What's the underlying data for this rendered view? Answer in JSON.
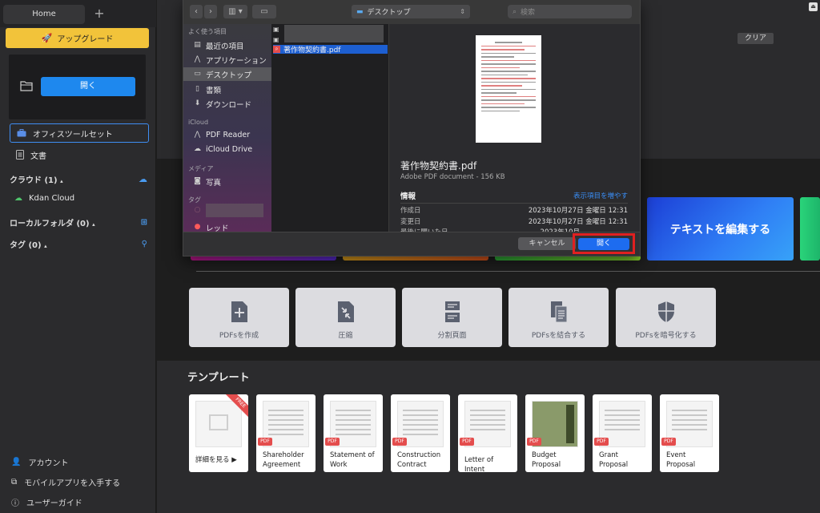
{
  "tabs": {
    "home": "Home",
    "add": "+"
  },
  "sidebar": {
    "upgrade": "アップグレード",
    "open_button": "開く",
    "office_toolset": "オフィスツールセット",
    "documents": "文書",
    "cloud": "クラウド (1)",
    "kdan_cloud": "Kdan Cloud",
    "local_folder": "ローカルフォルダ (0)",
    "tags": "タグ (0)",
    "account": "アカウント",
    "mobile_app": "モバイルアプリを入手する",
    "user_guide": "ユーザーガイド"
  },
  "main": {
    "clear": "クリア",
    "banner_edit_text": "テキストを編集する",
    "tools": [
      {
        "label": "PDFsを作成"
      },
      {
        "label": "圧縮"
      },
      {
        "label": "分割頁面"
      },
      {
        "label": "PDFsを結合する"
      },
      {
        "label": "PDFsを暗号化する"
      }
    ],
    "templates_title": "テンプレート",
    "templates": [
      {
        "name": "詳細を見る ▶",
        "badge": "FREE"
      },
      {
        "name": "Shareholder Agreement",
        "tag": "PDF"
      },
      {
        "name": "Statement of Work",
        "tag": "PDF"
      },
      {
        "name": "Construction Contract",
        "tag": "PDF"
      },
      {
        "name": "Letter of Intent",
        "tag": "PDF"
      },
      {
        "name": "Budget Proposal",
        "tag": "PDF"
      },
      {
        "name": "Grant Proposal",
        "tag": "PDF"
      },
      {
        "name": "Event Proposal",
        "tag": "PDF"
      }
    ]
  },
  "dialog": {
    "location": "デスクトップ",
    "search_placeholder": "検索",
    "favorites_header": "よく使う項目",
    "favorites": [
      "最近の項目",
      "アプリケーション",
      "デスクトップ",
      "書類",
      "ダウンロード"
    ],
    "icloud_header": "iCloud",
    "icloud": [
      "PDF Reader",
      "iCloud Drive"
    ],
    "media_header": "メディア",
    "media": [
      "写真"
    ],
    "tags_header": "タグ",
    "tag_red": "レッド",
    "selected_file": "著作物契約書.pdf",
    "preview": {
      "name": "著作物契約書.pdf",
      "subtitle": "Adobe PDF document - 156 KB",
      "info_header": "情報",
      "show_more": "表示項目を増やす",
      "rows": [
        {
          "key": "作成日",
          "value": "2023年10月27日 金曜日 12:31"
        },
        {
          "key": "変更日",
          "value": "2023年10月27日 金曜日 12:31"
        },
        {
          "key": "最後に開いた日",
          "value": "2023年10月"
        }
      ]
    },
    "cancel": "キャンセル",
    "open": "開く"
  }
}
